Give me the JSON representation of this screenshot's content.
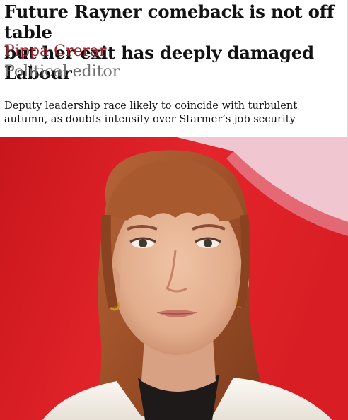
{
  "article": {
    "headline_line1": "Future Rayner comeback is not off table",
    "headline_line2": "but her exit has deeply damaged Labour",
    "author": "Pippa Crerar",
    "author_role": "Political editor",
    "standfirst_line1": "Deputy leadership race likely to coincide with turbulent",
    "standfirst_line2": "autumn, as doubts intensify over Starmer’s job security"
  },
  "image": {
    "subject": "portrait-photo",
    "colors": {
      "background_red": "#d81e24",
      "background_pink": "#f2c9d4",
      "hair": "#a6562c",
      "skin": "#e9b89a",
      "jacket": "#f4f0ea"
    }
  }
}
